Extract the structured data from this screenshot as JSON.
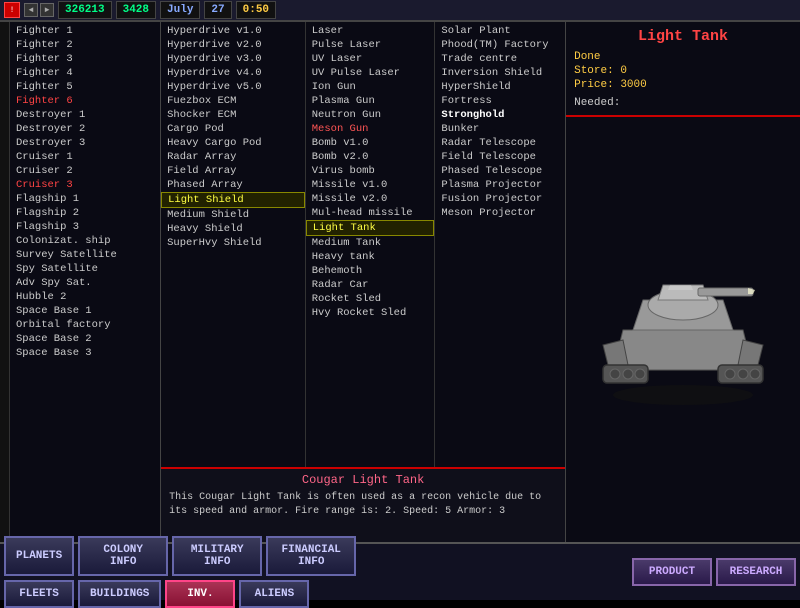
{
  "topbar": {
    "icon_label": "!",
    "arrows": [
      "◄",
      "►"
    ],
    "score": "326213",
    "resource": "3428",
    "month": "July",
    "day": "27",
    "time": "0:50",
    "extra_icons": [
      "▣",
      "▣"
    ]
  },
  "ships": [
    {
      "label": "Fighter 1",
      "class": ""
    },
    {
      "label": "Fighter 2",
      "class": ""
    },
    {
      "label": "Fighter 3",
      "class": ""
    },
    {
      "label": "Fighter 4",
      "class": ""
    },
    {
      "label": "Fighter 5",
      "class": ""
    },
    {
      "label": "Fighter 6",
      "class": "red"
    },
    {
      "label": "Destroyer 1",
      "class": ""
    },
    {
      "label": "Destroyer 2",
      "class": ""
    },
    {
      "label": "Destroyer 3",
      "class": ""
    },
    {
      "label": "Cruiser 1",
      "class": ""
    },
    {
      "label": "Cruiser 2",
      "class": ""
    },
    {
      "label": "Cruiser 3",
      "class": "red"
    },
    {
      "label": "Flagship 1",
      "class": ""
    },
    {
      "label": "Flagship 2",
      "class": ""
    },
    {
      "label": "Flagship 3",
      "class": ""
    },
    {
      "label": "Colonizat. ship",
      "class": ""
    },
    {
      "label": "Survey Satellite",
      "class": ""
    },
    {
      "label": "Spy Satellite",
      "class": ""
    },
    {
      "label": "Adv Spy Sat.",
      "class": ""
    },
    {
      "label": "Hubble 2",
      "class": ""
    },
    {
      "label": "Space Base 1",
      "class": ""
    },
    {
      "label": "Orbital factory",
      "class": ""
    },
    {
      "label": "Space Base 2",
      "class": ""
    },
    {
      "label": "Space Base 3",
      "class": ""
    }
  ],
  "weapons": [
    {
      "label": "Hyperdrive v1.0",
      "class": ""
    },
    {
      "label": "Hyperdrive v2.0",
      "class": ""
    },
    {
      "label": "Hyperdrive v3.0",
      "class": ""
    },
    {
      "label": "Hyperdrive v4.0",
      "class": ""
    },
    {
      "label": "Hyperdrive v5.0",
      "class": ""
    },
    {
      "label": "Fuezbox ECM",
      "class": ""
    },
    {
      "label": "Shocker ECM",
      "class": ""
    },
    {
      "label": "Cargo Pod",
      "class": ""
    },
    {
      "label": "Heavy Cargo Pod",
      "class": ""
    },
    {
      "label": "Radar Array",
      "class": ""
    },
    {
      "label": "Field Array",
      "class": ""
    },
    {
      "label": "Phased Array",
      "class": ""
    },
    {
      "label": "Light Shield",
      "class": ""
    },
    {
      "label": "Medium Shield",
      "class": ""
    },
    {
      "label": "Heavy Shield",
      "class": ""
    },
    {
      "label": "SuperHvy Shield",
      "class": ""
    }
  ],
  "items_col2": [
    {
      "label": "Laser",
      "class": ""
    },
    {
      "label": "Pulse Laser",
      "class": ""
    },
    {
      "label": "UV Laser",
      "class": ""
    },
    {
      "label": "UV Pulse Laser",
      "class": ""
    },
    {
      "label": "Ion Gun",
      "class": ""
    },
    {
      "label": "Plasma Gun",
      "class": ""
    },
    {
      "label": "Neutron Gun",
      "class": ""
    },
    {
      "label": "Meson Gun",
      "class": "red"
    },
    {
      "label": "Bomb v1.0",
      "class": ""
    },
    {
      "label": "Bomb v2.0",
      "class": ""
    },
    {
      "label": "Virus bomb",
      "class": ""
    },
    {
      "label": "Missile v1.0",
      "class": ""
    },
    {
      "label": "Missile v2.0",
      "class": ""
    },
    {
      "label": "Mul-head missile",
      "class": ""
    },
    {
      "label": "Light Tank",
      "class": "selected"
    },
    {
      "label": "Medium Tank",
      "class": ""
    },
    {
      "label": "Heavy tank",
      "class": ""
    },
    {
      "label": "Behemoth",
      "class": ""
    },
    {
      "label": "Radar Car",
      "class": ""
    },
    {
      "label": "Rocket Sled",
      "class": ""
    },
    {
      "label": "Hvy Rocket Sled",
      "class": ""
    }
  ],
  "items_col3": [
    {
      "label": "Solar Plant",
      "class": ""
    },
    {
      "label": "Phood(TM) Factory",
      "class": ""
    },
    {
      "label": "Trade centre",
      "class": ""
    },
    {
      "label": "Inversion Shield",
      "class": ""
    },
    {
      "label": "HyperShield",
      "class": ""
    },
    {
      "label": "Fortress",
      "class": ""
    },
    {
      "label": "Stronghold",
      "class": "bold"
    },
    {
      "label": "Bunker",
      "class": ""
    },
    {
      "label": "Radar Telescope",
      "class": ""
    },
    {
      "label": "Field Telescope",
      "class": ""
    },
    {
      "label": "Phased Telescope",
      "class": ""
    },
    {
      "label": "Plasma Projector",
      "class": ""
    },
    {
      "label": "Fusion Projector",
      "class": ""
    },
    {
      "label": "Meson Projector",
      "class": ""
    }
  ],
  "right_panel": {
    "title": "Light Tank",
    "done_label": "Done",
    "store_label": "Store:",
    "store_value": "0",
    "price_label": "Price:",
    "price_value": "3000",
    "needed_label": "Needed:"
  },
  "info_bar": {
    "title": "Cougar Light Tank",
    "description": "This Cougar Light Tank is often used as a recon vehicle due to its speed and armor. Fire range is: 2.  Speed: 5  Armor: 3"
  },
  "bottom_buttons": {
    "row1": [
      {
        "label": "PLANETS",
        "active": false
      },
      {
        "label": "COLONY\nINFO",
        "active": false
      },
      {
        "label": "MILITARY\nINFO",
        "active": false
      },
      {
        "label": "FINANCIAL\nINFO",
        "active": false
      }
    ],
    "row2": [
      {
        "label": "FLEETS",
        "active": false
      },
      {
        "label": "BUILDINGS",
        "active": false
      },
      {
        "label": "INV.",
        "active": true
      },
      {
        "label": "ALIENS",
        "active": false
      }
    ],
    "right_buttons": [
      {
        "label": "PRODUCT",
        "active": false
      },
      {
        "label": "RESEARCH",
        "active": false
      }
    ]
  }
}
